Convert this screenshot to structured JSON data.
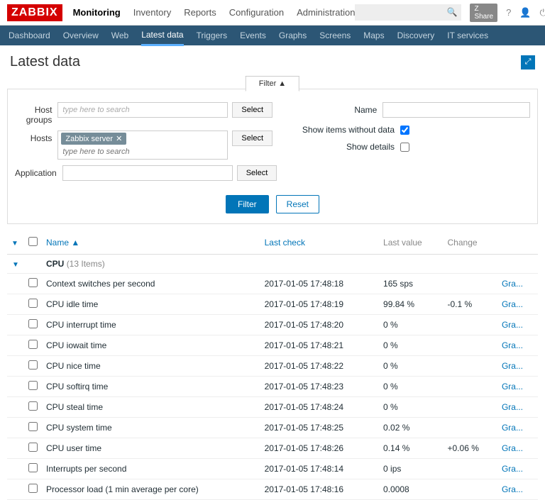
{
  "logo": "ZABBIX",
  "topnav": [
    "Monitoring",
    "Inventory",
    "Reports",
    "Configuration",
    "Administration"
  ],
  "topnav_active": 0,
  "share_label": "Z Share",
  "subnav": [
    "Dashboard",
    "Overview",
    "Web",
    "Latest data",
    "Triggers",
    "Events",
    "Graphs",
    "Screens",
    "Maps",
    "Discovery",
    "IT services"
  ],
  "subnav_active": 3,
  "page_title": "Latest data",
  "filter": {
    "tab_label": "Filter ▲",
    "host_groups_label": "Host groups",
    "host_groups_placeholder": "type here to search",
    "hosts_label": "Hosts",
    "hosts_tag": "Zabbix server",
    "hosts_placeholder": "type here to search",
    "application_label": "Application",
    "name_label": "Name",
    "show_without_data_label": "Show items without data",
    "show_without_data_checked": true,
    "show_details_label": "Show details",
    "show_details_checked": false,
    "select_label": "Select",
    "filter_btn": "Filter",
    "reset_btn": "Reset"
  },
  "columns": {
    "name": "Name ▲",
    "last_check": "Last check",
    "last_value": "Last value",
    "change": "Change"
  },
  "group": {
    "name": "CPU",
    "count": "(13 Items)"
  },
  "rows": [
    {
      "name": "Context switches per second",
      "last_check": "2017-01-05 17:48:18",
      "last_value": "165 sps",
      "change": "",
      "link": "Gra..."
    },
    {
      "name": "CPU idle time",
      "last_check": "2017-01-05 17:48:19",
      "last_value": "99.84 %",
      "change": "-0.1 %",
      "link": "Gra..."
    },
    {
      "name": "CPU interrupt time",
      "last_check": "2017-01-05 17:48:20",
      "last_value": "0 %",
      "change": "",
      "link": "Gra..."
    },
    {
      "name": "CPU iowait time",
      "last_check": "2017-01-05 17:48:21",
      "last_value": "0 %",
      "change": "",
      "link": "Gra..."
    },
    {
      "name": "CPU nice time",
      "last_check": "2017-01-05 17:48:22",
      "last_value": "0 %",
      "change": "",
      "link": "Gra..."
    },
    {
      "name": "CPU softirq time",
      "last_check": "2017-01-05 17:48:23",
      "last_value": "0 %",
      "change": "",
      "link": "Gra..."
    },
    {
      "name": "CPU steal time",
      "last_check": "2017-01-05 17:48:24",
      "last_value": "0 %",
      "change": "",
      "link": "Gra..."
    },
    {
      "name": "CPU system time",
      "last_check": "2017-01-05 17:48:25",
      "last_value": "0.02 %",
      "change": "",
      "link": "Gra..."
    },
    {
      "name": "CPU user time",
      "last_check": "2017-01-05 17:48:26",
      "last_value": "0.14 %",
      "change": "+0.06 %",
      "link": "Gra..."
    },
    {
      "name": "Interrupts per second",
      "last_check": "2017-01-05 17:48:14",
      "last_value": "0 ips",
      "change": "",
      "link": "Gra..."
    },
    {
      "name": "Processor load (1 min average per core)",
      "last_check": "2017-01-05 17:48:16",
      "last_value": "0.0008",
      "change": "",
      "link": "Gra..."
    }
  ]
}
